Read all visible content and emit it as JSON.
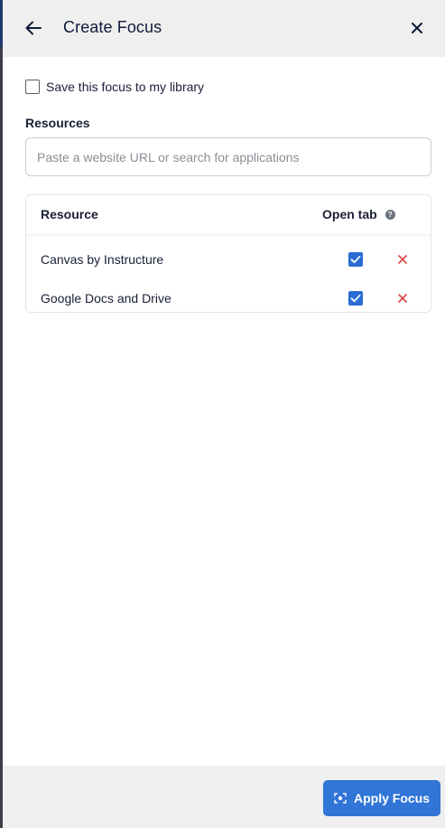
{
  "header": {
    "title": "Create Focus",
    "back_icon": "arrow-left-icon",
    "close_icon": "close-icon"
  },
  "save_option": {
    "label": "Save this focus to my library",
    "checked": false
  },
  "resources": {
    "label": "Resources",
    "search_placeholder": "Paste a website URL or search for applications",
    "search_value": ""
  },
  "table": {
    "columns": {
      "resource": "Resource",
      "open_tab": "Open tab",
      "help_icon": "question-circle-icon"
    },
    "rows": [
      {
        "name": "Canvas by Instructure",
        "open_tab": true
      },
      {
        "name": "Google Docs and Drive",
        "open_tab": true
      }
    ]
  },
  "footer": {
    "apply_label": "Apply Focus",
    "apply_icon": "focus-target-icon"
  },
  "colors": {
    "accent": "#3275d8",
    "remove": "#d64545",
    "header_bg": "#efefef"
  }
}
